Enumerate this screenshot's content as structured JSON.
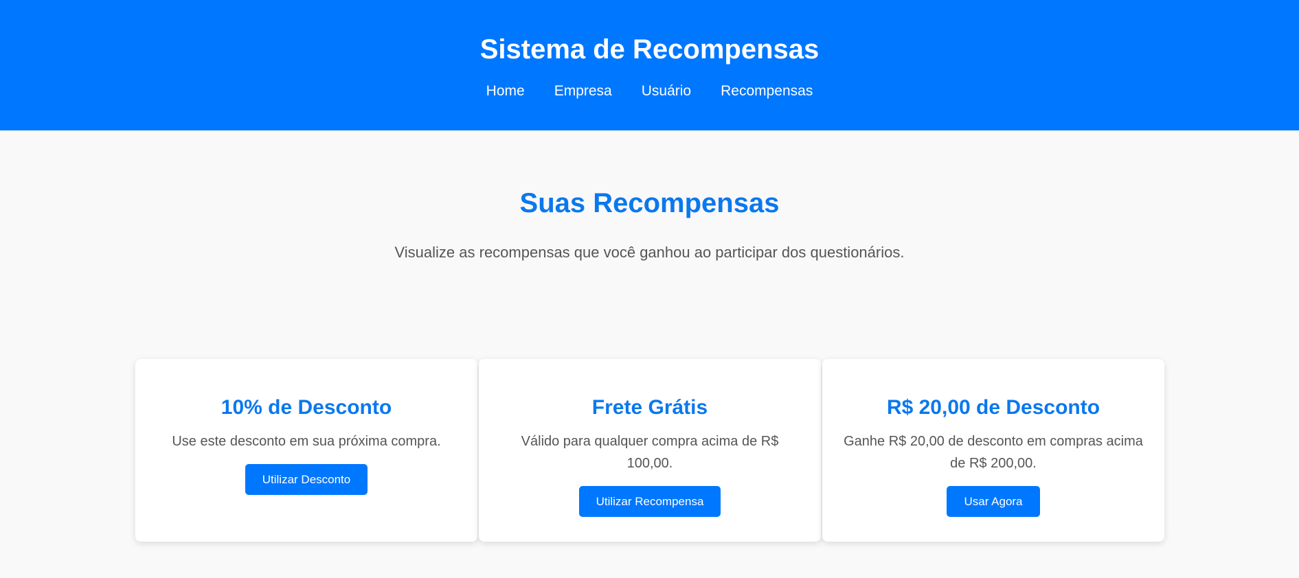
{
  "header": {
    "title": "Sistema de Recompensas",
    "nav": [
      {
        "label": "Home"
      },
      {
        "label": "Empresa"
      },
      {
        "label": "Usuário"
      },
      {
        "label": "Recompensas"
      }
    ]
  },
  "main": {
    "title": "Suas Recompensas",
    "subtitle": "Visualize as recompensas que você ganhou ao participar dos questionários."
  },
  "rewards": [
    {
      "title": "10% de Desconto",
      "description": "Use este desconto em sua próxima compra.",
      "button": "Utilizar Desconto"
    },
    {
      "title": "Frete Grátis",
      "description": "Válido para qualquer compra acima de R$ 100,00.",
      "button": "Utilizar Recompensa"
    },
    {
      "title": "R$ 20,00 de Desconto",
      "description": "Ganhe R$ 20,00 de desconto em compras acima de R$ 200,00.",
      "button": "Usar Agora"
    }
  ],
  "colors": {
    "primary": "#0077ff",
    "heading": "#0a78ee",
    "background": "#f9f9f9",
    "text": "#555555"
  }
}
